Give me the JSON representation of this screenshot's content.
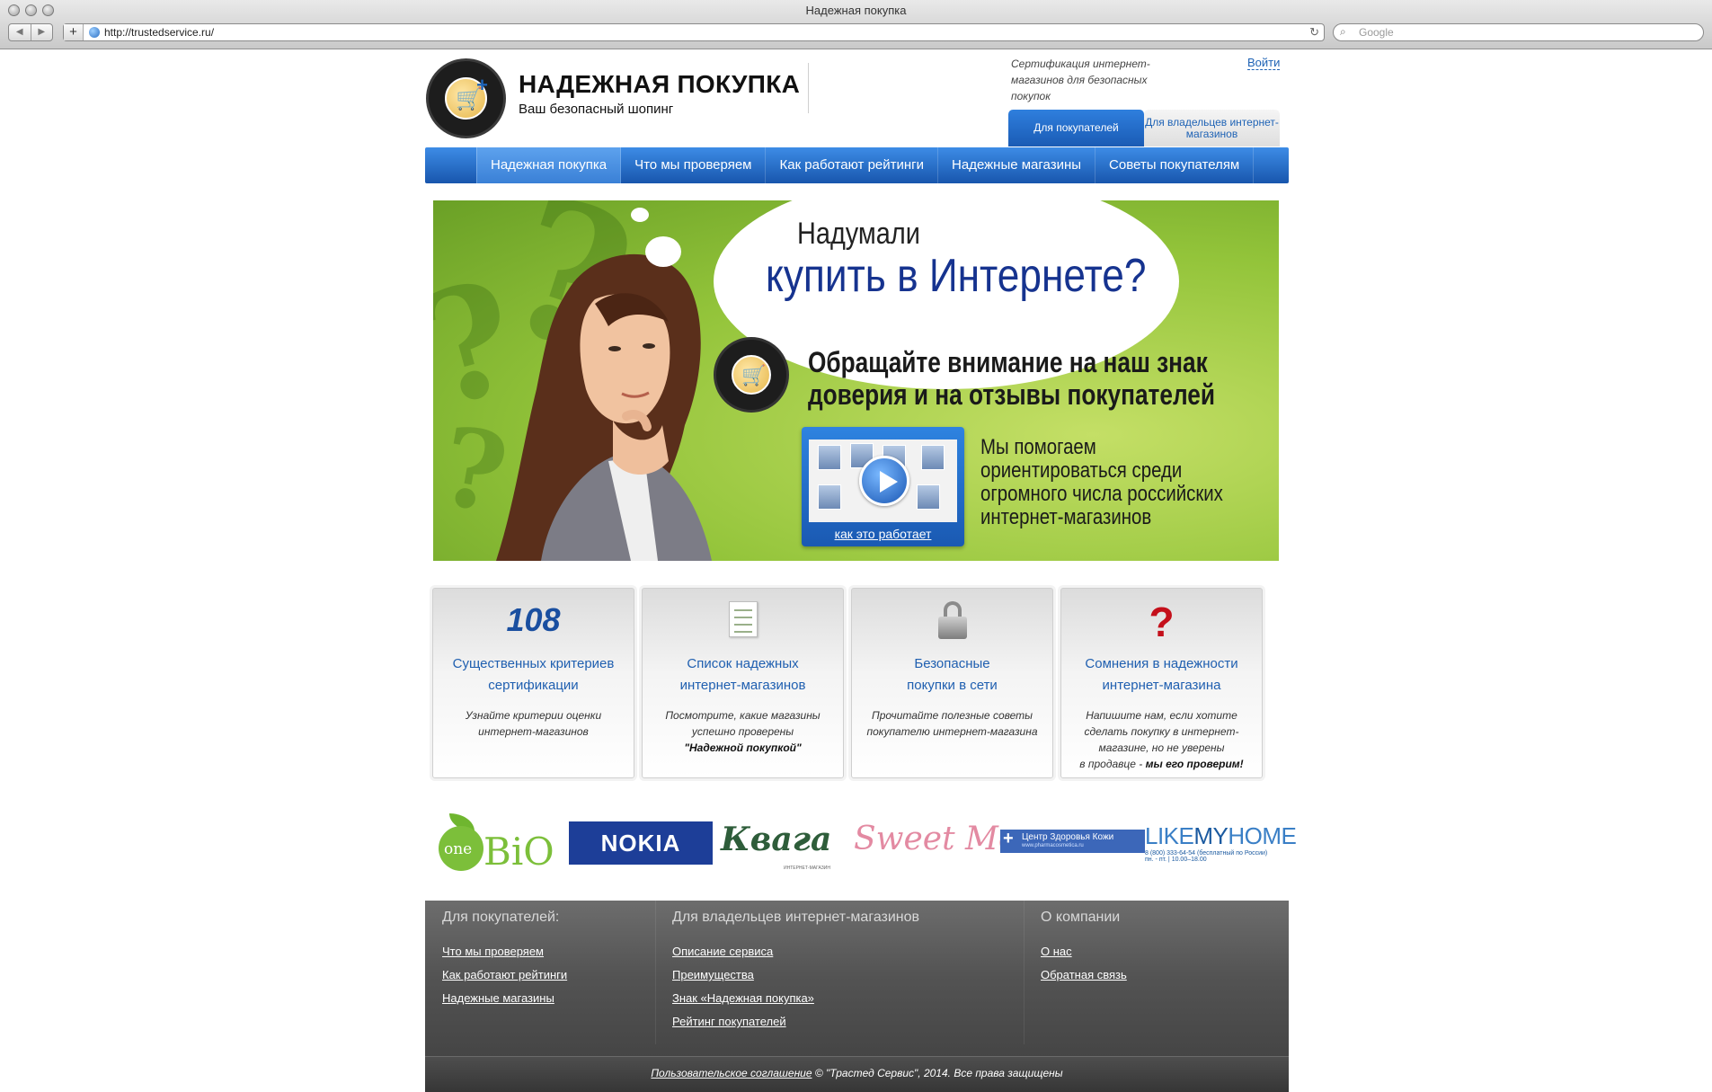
{
  "browser": {
    "window_title": "Надежная покупка",
    "url": "http://trustedservice.ru/",
    "search_placeholder": "Google"
  },
  "header": {
    "brand_name": "НАДЕЖНАЯ ПОКУПКА",
    "brand_tagline": "Ваш безопасный шопинг",
    "certification_text": "Сертификация интернет-магазинов для безопасных покупок",
    "login_label": "Войти",
    "audience_tabs": [
      "Для покупателей",
      "Для владельцев интернет-магазинов"
    ]
  },
  "nav": {
    "items": [
      "Надежная покупка",
      "Что мы проверяем",
      "Как работают рейтинги",
      "Надежные магазины",
      "Советы покупателям"
    ],
    "active_index": 0
  },
  "banner": {
    "cloud_line1": "Надумали",
    "cloud_line2": "купить в Интернете?",
    "trust_line1": "Обращайте внимание на наш знак",
    "trust_line2": "доверия и на отзывы покупателей",
    "video_link": "как это работает",
    "help_line1": "Мы помогаем",
    "help_line2": "ориентироваться среди",
    "help_line3": "огромного числа российских",
    "help_line4": "интернет-магазинов"
  },
  "features": [
    {
      "number": "108",
      "title_line1": "Существенных критериев",
      "title_line2": "сертификации",
      "desc_line1": "Узнайте критерии оценки",
      "desc_line2": "интернет-магазинов"
    },
    {
      "icon": "checklist-icon",
      "title_line1": "Список надежных",
      "title_line2": "интернет-магазинов",
      "desc_line1": "Посмотрите, какие магазины",
      "desc_line2": "успешно проверены",
      "desc_bold": "\"Надежной покупкой\""
    },
    {
      "icon": "lock-icon",
      "title_line1": "Безопасные",
      "title_line2": "покупки в сети",
      "desc_line1": "Прочитайте полезные советы",
      "desc_line2": "покупателю интернет-магазина"
    },
    {
      "icon": "question-icon",
      "title_line1": "Сомнения в надежности",
      "title_line2": "интернет-магазина",
      "desc_line1": "Напишите нам, если хотите",
      "desc_line2": "сделать покупку в интернет-",
      "desc_line3": "магазине, но не уверены",
      "desc_line4": "в продавце - ",
      "desc_bold": "мы его проверим!"
    }
  ],
  "partner_logos": {
    "onebio_one": "one",
    "onebio_bio": "BiO",
    "nokia": "NOKIA",
    "kvaga": "Квага",
    "kvaga_sub": "ИНТЕРНЕТ-МАГАЗИН",
    "sweetme": "Sweet Me",
    "czk_name": "Центр Здоровья Кожи",
    "czk_url": "www.pharmacosmetica.ru",
    "likemyhome_like": "LIKE",
    "likemyhome_my": "MY",
    "likemyhome_home": "HOME",
    "likemyhome_phone": "8 (800) 333-64-54 (бесплатный по России)",
    "likemyhome_hours": "пн. - пт. | 10.00–18.00"
  },
  "footer": {
    "buyers_heading": "Для покупателей:",
    "buyers_links": [
      "Что мы проверяем",
      "Как работают рейтинги",
      "Надежные магазины"
    ],
    "owners_heading": "Для владельцев интернет-магазинов",
    "owners_links": [
      "Описание сервиса",
      "Преимущества",
      "Знак «Надежная покупка»",
      "Рейтинг покупателей"
    ],
    "company_heading": "О компании",
    "company_links": [
      "О нас",
      "Обратная связь"
    ],
    "agreement_link": "Пользовательское соглашение",
    "copyright": "© \"Трастед Сервис\", 2014. Все права защищены"
  },
  "colors": {
    "nav_blue": "#1856ad",
    "link_blue": "#1f5fb0",
    "banner_green": "#93c43a",
    "footer_gray": "#535353",
    "question_red": "#c4101b"
  }
}
